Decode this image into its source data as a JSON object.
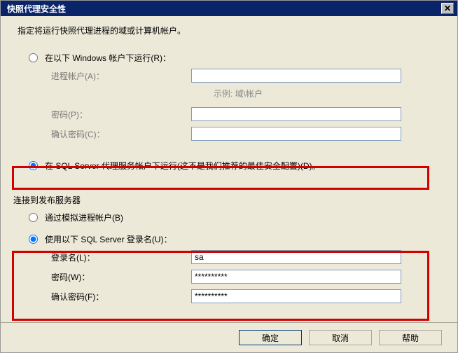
{
  "titlebar": {
    "text": "快照代理安全性",
    "close": "✕"
  },
  "instruction": "指定将运行快照代理进程的域或计算机帐户。",
  "top": {
    "radio1": "在以下 Windows 帐户下运行(R)：",
    "process_account_label": "进程帐户(A)：",
    "example": "示例: 域\\帐户",
    "password_label": "密码(P)：",
    "confirm_label": "确认密码(C)：",
    "radio2": "在 SQL Server 代理服务帐户下运行(这不是我们推荐的最佳安全配置)(D)。"
  },
  "publisher": {
    "section_title": "连接到发布服务器",
    "radio1": "通过模拟进程帐户(B)",
    "radio2": "使用以下 SQL Server 登录名(U)：",
    "login_label": "登录名(L)：",
    "login_value": "sa",
    "password_label": "密码(W)：",
    "password_value": "**********",
    "confirm_label": "确认密码(F)：",
    "confirm_value": "**********"
  },
  "buttons": {
    "ok": "确定",
    "cancel": "取消",
    "help": "帮助"
  }
}
